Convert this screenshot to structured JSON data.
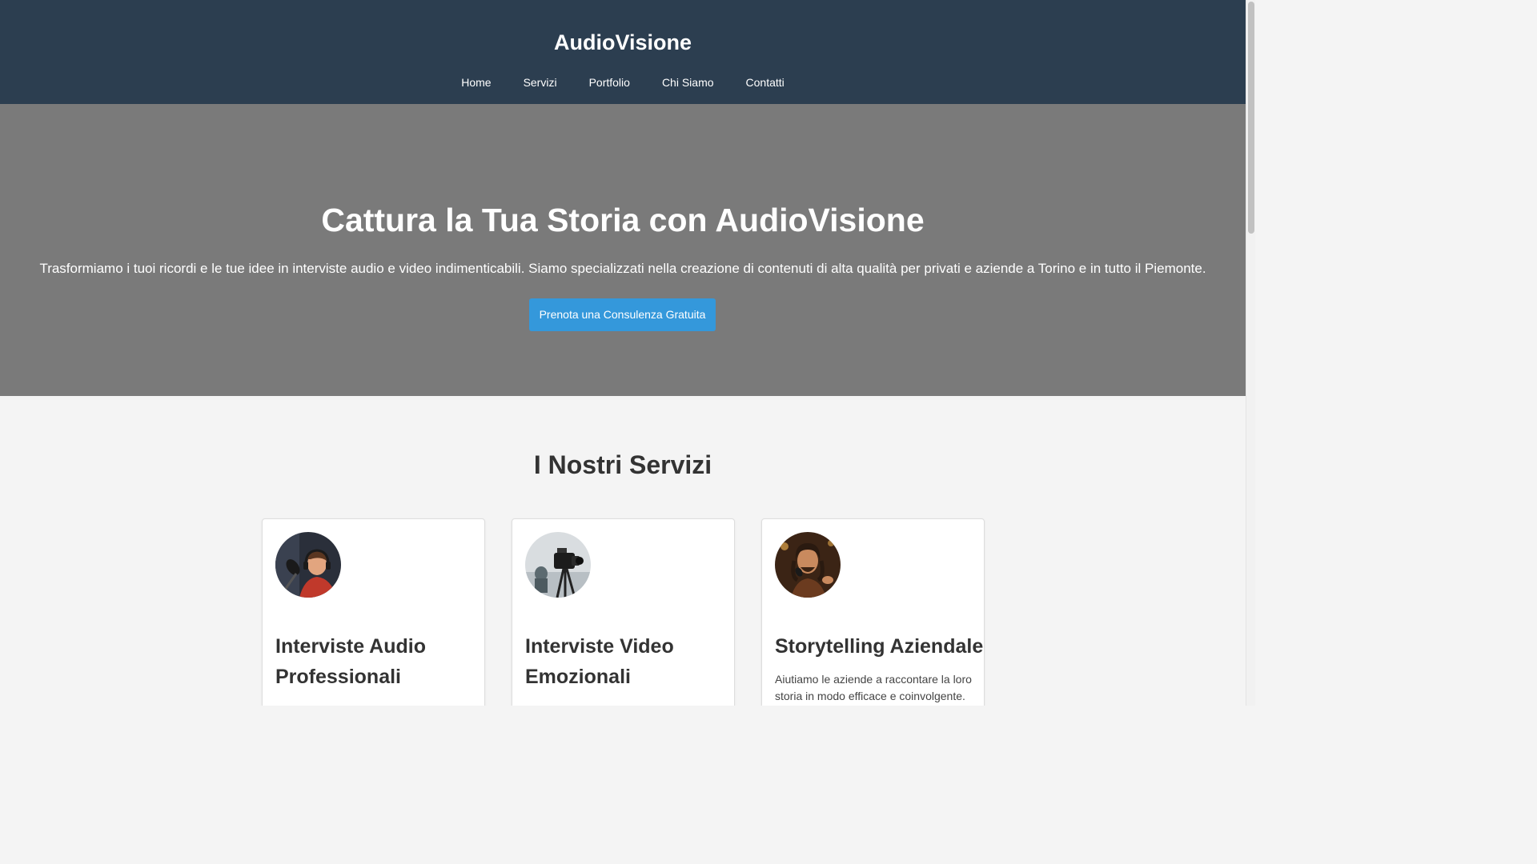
{
  "header": {
    "brand": "AudioVisione",
    "nav": [
      "Home",
      "Servizi",
      "Portfolio",
      "Chi Siamo",
      "Contatti"
    ]
  },
  "hero": {
    "title": "Cattura la Tua Storia con AudioVisione",
    "text": "Trasformiamo i tuoi ricordi e le tue idee in interviste audio e video indimenticabili. Siamo specializzati nella creazione di contenuti di alta qualità per privati e aziende a Torino e in tutto il Piemonte.",
    "cta_label": "Prenota una Consulenza Gratuita"
  },
  "services": {
    "title": "I Nostri Servizi",
    "cards": [
      {
        "title": "Interviste Audio Professionali",
        "text": "",
        "image": "podcaster-microphone-image"
      },
      {
        "title": "Interviste Video Emozionali",
        "text": "",
        "image": "video-camera-image"
      },
      {
        "title": "Storytelling Aziendale",
        "text": "Aiutiamo le aziende a raccontare la loro storia in modo efficace e coinvolgente.",
        "image": "singer-microphone-image"
      }
    ]
  },
  "colors": {
    "header_bg": "#2c3e50",
    "hero_bg": "#7a7a7a",
    "accent": "#3498db",
    "page_bg": "#f4f4f4"
  }
}
